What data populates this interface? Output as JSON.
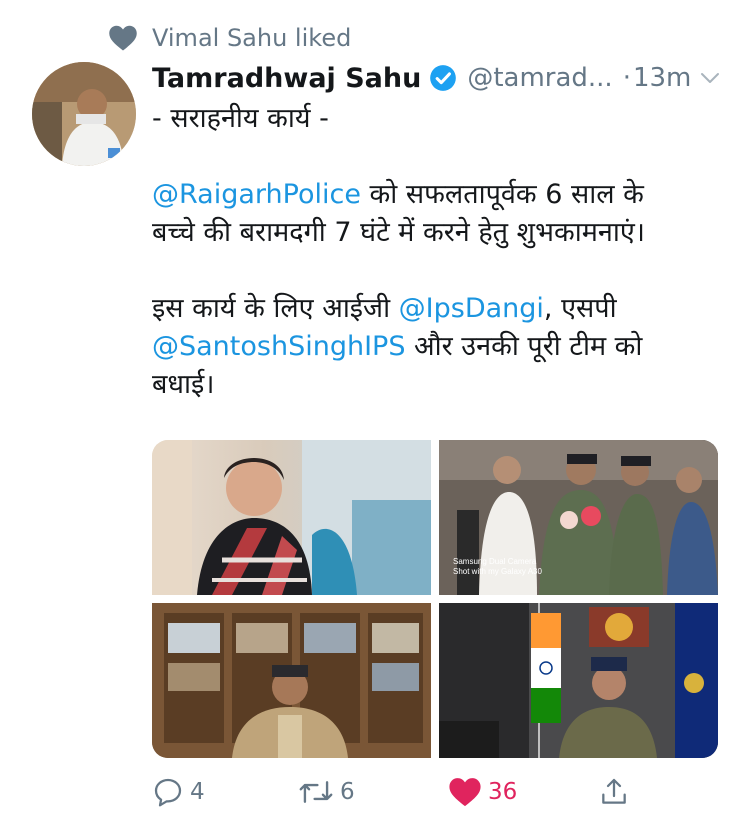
{
  "liked_by": {
    "text": "Vimal Sahu liked",
    "icon": "heart-icon"
  },
  "tweet": {
    "author_name": "Tamradhwaj Sahu",
    "verified": true,
    "handle": "@tamrad...",
    "time": "13m",
    "separator": "·",
    "lines": {
      "line1": "- सराहनीय कार्य -",
      "p2_mention": "@RaigarhPolice",
      "p2_text_a": " को सफलतापूर्वक 6 साल के",
      "p2_text_b": "बच्चे की बरामदगी 7 घंटे में करने हेतु शुभकामनाएं।",
      "p3_text_a": "इस कार्य के लिए आईजी ",
      "p3_mention_a": "@IpsDangi",
      "p3_text_b": ", एसपी",
      "p3_mention_b": "@SantoshSinghIPS",
      "p3_text_c": " और उनकी पूरी टीम को",
      "p3_text_d": "बधाई।"
    },
    "media": {
      "watermark_line1": "Samsung Dual Camera",
      "watermark_line2": "Shot with my Galaxy A30"
    },
    "actions": {
      "reply_count": "4",
      "retweet_count": "6",
      "like_count": "36"
    }
  },
  "colors": {
    "link": "#1b95e0",
    "secondary": "#657786",
    "like": "#e0245e",
    "verified": "#1da1f2"
  }
}
